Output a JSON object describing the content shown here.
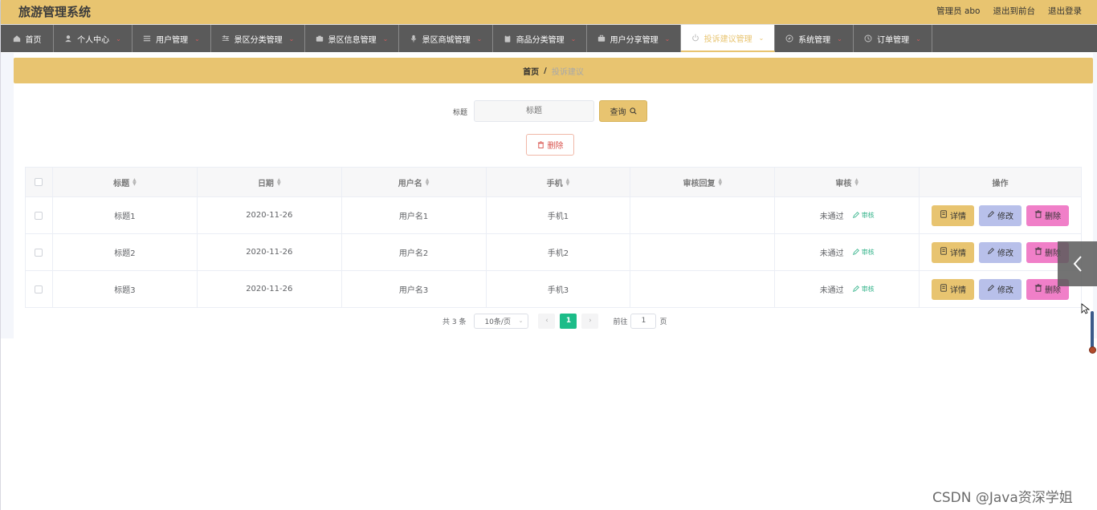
{
  "app": {
    "title": "旅游管理系统"
  },
  "header": {
    "user_label": "管理员 abo",
    "front_label": "退出到前台",
    "logout_label": "退出登录"
  },
  "nav": [
    {
      "label": "首页",
      "icon": "home-icon",
      "caret": false
    },
    {
      "label": "个人中心",
      "icon": "user-icon",
      "caret": true
    },
    {
      "label": "用户管理",
      "icon": "list-icon",
      "caret": true
    },
    {
      "label": "景区分类管理",
      "icon": "sliders-icon",
      "caret": true
    },
    {
      "label": "景区信息管理",
      "icon": "camera-icon",
      "caret": true
    },
    {
      "label": "景区商城管理",
      "icon": "mic-icon",
      "caret": true
    },
    {
      "label": "商品分类管理",
      "icon": "clipboard-icon",
      "caret": true
    },
    {
      "label": "用户分享管理",
      "icon": "briefcase-icon",
      "caret": true
    },
    {
      "label": "投诉建议管理",
      "icon": "power-icon",
      "caret": true,
      "active": true
    },
    {
      "label": "系统管理",
      "icon": "compass-icon",
      "caret": true
    },
    {
      "label": "订单管理",
      "icon": "clock-icon",
      "caret": true
    }
  ],
  "breadcrumb": {
    "home": "首页",
    "separator": "/",
    "current": "投诉建议"
  },
  "search": {
    "label": "标题",
    "placeholder": "标题",
    "button_label": "查询"
  },
  "toolbar": {
    "delete_label": "删除"
  },
  "table": {
    "columns": [
      "标题",
      "日期",
      "用户名",
      "手机",
      "审核回复",
      "审核",
      "操作"
    ],
    "audit_link_label": "审核",
    "actions": {
      "detail": "详情",
      "edit": "修改",
      "delete": "删除"
    },
    "rows": [
      {
        "title": "标题1",
        "date": "2020-11-26",
        "username": "用户名1",
        "phone": "手机1",
        "reply": "",
        "status": "未通过"
      },
      {
        "title": "标题2",
        "date": "2020-11-26",
        "username": "用户名2",
        "phone": "手机2",
        "reply": "",
        "status": "未通过"
      },
      {
        "title": "标题3",
        "date": "2020-11-26",
        "username": "用户名3",
        "phone": "手机3",
        "reply": "",
        "status": "未通过"
      }
    ]
  },
  "pagination": {
    "total_label": "共 3 条",
    "page_size_label": "10条/页",
    "current_page": "1",
    "goto_label": "前往",
    "goto_value": "1",
    "page_suffix": "页"
  },
  "watermark": "CSDN @Java资深学姐",
  "colors": {
    "accent": "#e8c470",
    "nav_bg": "#5a5a5a",
    "edit_button": "#b8c0ea",
    "delete_button": "#f07fc8",
    "pager_active": "#1cbc88"
  }
}
